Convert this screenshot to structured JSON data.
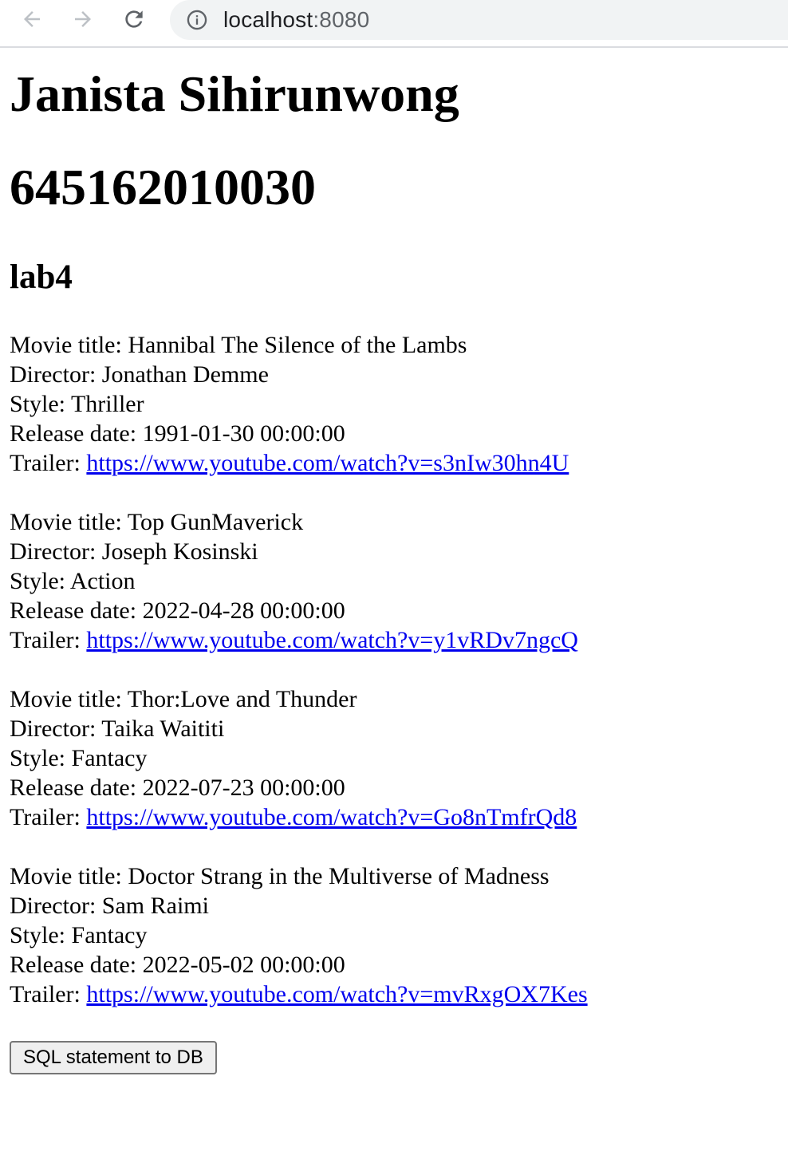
{
  "browser": {
    "url_host": "localhost",
    "url_port": ":8080",
    "back_icon": "arrow-left-icon",
    "forward_icon": "arrow-right-icon",
    "reload_icon": "reload-icon",
    "info_icon": "info-icon"
  },
  "page": {
    "name": "Janista Sihirunwong",
    "student_id": "645162010030",
    "lab": "lab4"
  },
  "labels": {
    "title": "Movie title: ",
    "director": "Director: ",
    "style": "Style: ",
    "release": "Release date: ",
    "trailer": "Trailer: "
  },
  "movies": [
    {
      "title": "Hannibal The Silence of the Lambs",
      "director": "Jonathan Demme",
      "style": "Thriller",
      "release": "1991-01-30 00:00:00",
      "trailer": "https://www.youtube.com/watch?v=s3nIw30hn4U"
    },
    {
      "title": "Top GunMaverick",
      "director": "Joseph Kosinski",
      "style": "Action",
      "release": "2022-04-28 00:00:00",
      "trailer": "https://www.youtube.com/watch?v=y1vRDv7ngcQ"
    },
    {
      "title": "Thor:Love and Thunder",
      "director": "Taika Waititi",
      "style": "Fantacy",
      "release": "2022-07-23 00:00:00",
      "trailer": "https://www.youtube.com/watch?v=Go8nTmfrQd8"
    },
    {
      "title": "Doctor Strang in the Multiverse of Madness",
      "director": "Sam Raimi",
      "style": "Fantacy",
      "release": "2022-05-02 00:00:00",
      "trailer": "https://www.youtube.com/watch?v=mvRxgOX7Kes"
    }
  ],
  "actions": {
    "sql_button": "SQL statement to DB"
  },
  "colors": {
    "link": "#0000ee",
    "address_bar_bg": "#f1f3f4",
    "toolbar_icon": "#5f6368"
  }
}
